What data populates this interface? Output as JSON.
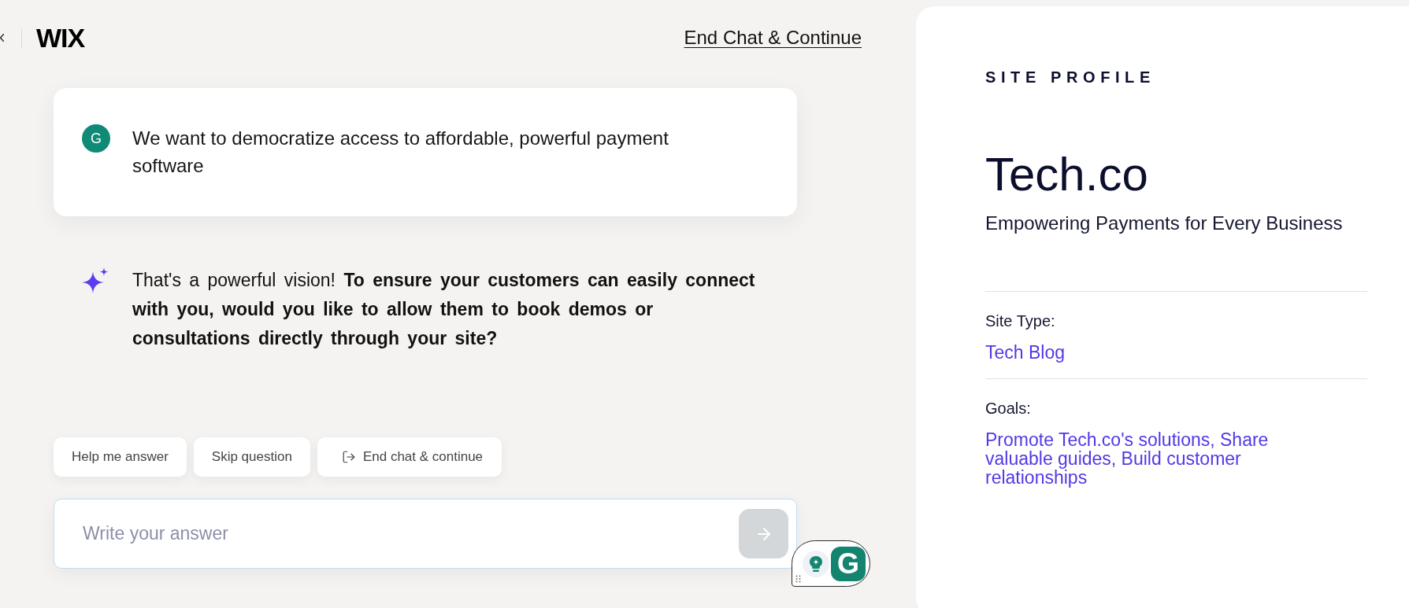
{
  "header": {
    "logo": "WIX",
    "end_chat_link": "End Chat & Continue"
  },
  "conversation": [
    {
      "kind": "user",
      "avatar": "G",
      "text": "We want to democratize access to affordable, powerful payment software"
    },
    {
      "kind": "assistant",
      "text": "That's a powerful vision! **To ensure your customers can easily connect with you, would you like to allow them to book demos or consultations directly through your site?**"
    }
  ],
  "quick_replies": [
    {
      "kind": "text",
      "label": "Help me answer"
    },
    {
      "kind": "text",
      "label": "Skip question"
    },
    {
      "kind": "exit",
      "label": "End chat & continue"
    }
  ],
  "answer_field": {
    "placeholder": "Write your answer"
  },
  "send_button": {
    "disabled": true
  },
  "floating_widget": {
    "logo": "G"
  },
  "site_profile": {
    "heading": "SITE PROFILE",
    "name": "Tech.co",
    "tagline": "Empowering Payments for Every Business",
    "fields": [
      {
        "label": "Site Type:",
        "value": "Tech Blog"
      },
      {
        "label": "Goals:",
        "value": "Promote Tech.co's solutions, Share valuable guides, Build customer relationships"
      }
    ]
  }
}
